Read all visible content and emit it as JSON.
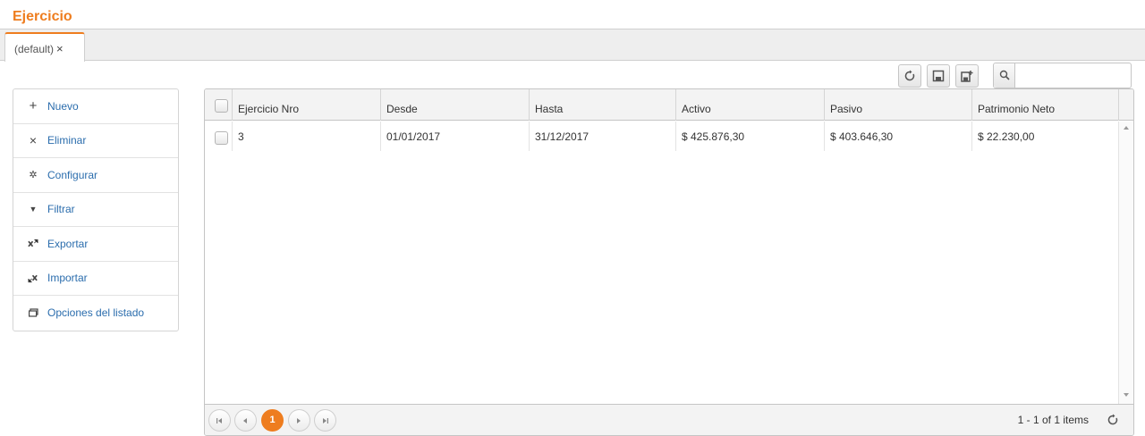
{
  "page": {
    "title": "Ejercicio"
  },
  "tabs": [
    {
      "label": "(default)",
      "close": "×"
    }
  ],
  "toolbar": {
    "buttons": [
      {
        "icon": "refresh-icon"
      },
      {
        "icon": "save-icon"
      },
      {
        "icon": "save-as-icon"
      }
    ],
    "search": {
      "icon": "search-icon",
      "value": "",
      "placeholder": ""
    }
  },
  "sidebar": {
    "items": [
      {
        "label": "Nuevo",
        "glyph": "+",
        "icon": "plus-icon"
      },
      {
        "label": "Eliminar",
        "glyph": "×",
        "icon": "close-icon"
      },
      {
        "label": "Configurar",
        "glyph": "✲",
        "icon": "gear-icon"
      },
      {
        "label": "Filtrar",
        "glyph": "▼",
        "icon": "filter-icon"
      },
      {
        "label": "Exportar",
        "glyph": "",
        "icon": "excel-export-icon"
      },
      {
        "label": "Importar",
        "glyph": "",
        "icon": "excel-import-icon"
      },
      {
        "label": "Opciones del listado",
        "glyph": "",
        "icon": "list-options-icon"
      }
    ]
  },
  "grid": {
    "columns": [
      "Ejercicio Nro",
      "Desde",
      "Hasta",
      "Activo",
      "Pasivo",
      "Patrimonio Neto"
    ],
    "rows": [
      [
        "3",
        "01/01/2017",
        "31/12/2017",
        "$ 425.876,30",
        "$ 403.646,30",
        "$ 22.230,00"
      ]
    ]
  },
  "pager": {
    "current_page": "1",
    "info": "1 - 1 of 1 items"
  },
  "colors": {
    "accent": "#ee7d1f",
    "link": "#2b6dad",
    "header_bg": "#f3f3f3",
    "border": "#c5c5c5"
  }
}
